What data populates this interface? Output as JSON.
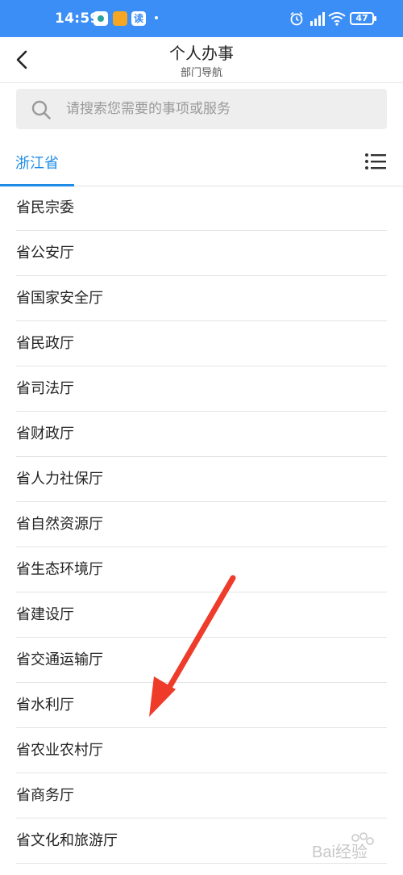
{
  "status_bar": {
    "time": "14:59",
    "app3_glyph": "读",
    "battery": "47",
    "icons": [
      "app-icon",
      "app-icon",
      "app-icon",
      "alarm-icon",
      "signal-icon",
      "wifi-icon",
      "battery-icon"
    ]
  },
  "header": {
    "title": "个人办事",
    "subtitle": "部门导航",
    "back_icon": "chevron-left-icon"
  },
  "search": {
    "placeholder": "请搜索您需要的事项或服务",
    "icon": "search-icon"
  },
  "tabs": {
    "active": "浙江省",
    "menu_icon": "list-menu-icon"
  },
  "departments": [
    "省民宗委",
    "省公安厅",
    "省国家安全厅",
    "省民政厅",
    "省司法厅",
    "省财政厅",
    "省人力社保厅",
    "省自然资源厅",
    "省生态环境厅",
    "省建设厅",
    "省交通运输厅",
    "省水利厅",
    "省农业农村厅",
    "省商务厅",
    "省文化和旅游厅"
  ],
  "watermark": {
    "text": "Bai经验"
  },
  "colors": {
    "status_bar": "#3b8ef5",
    "accent": "#1e8ce6",
    "annotation_arrow": "#ee3b2a"
  }
}
